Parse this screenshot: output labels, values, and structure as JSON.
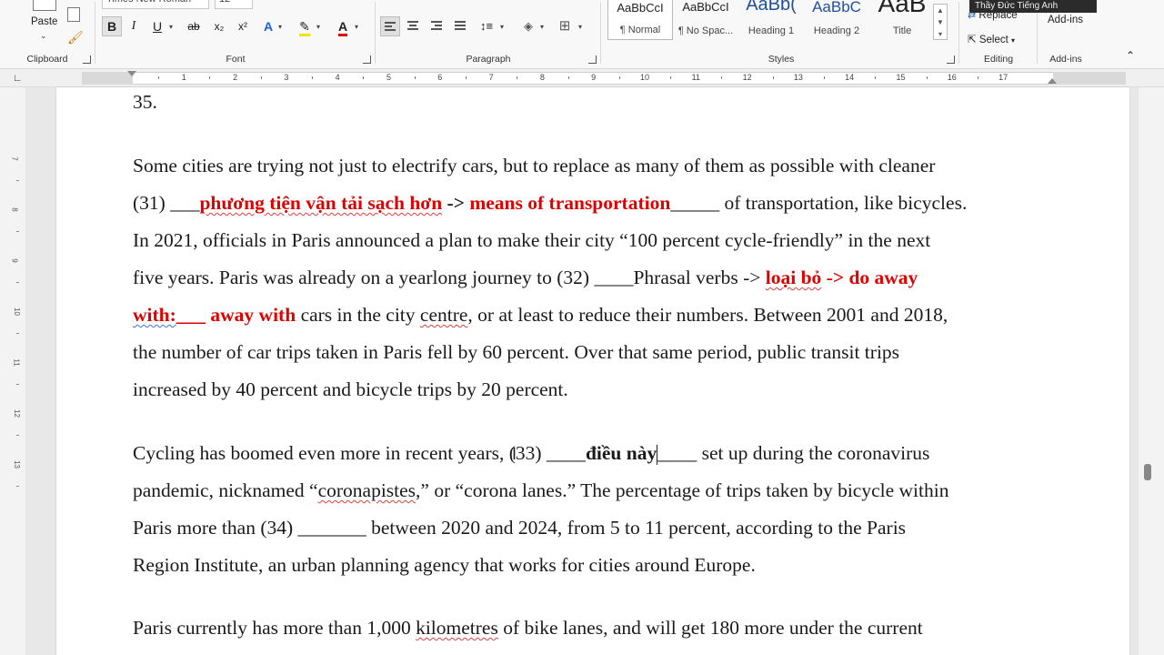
{
  "ribbon": {
    "presenter_label": "Thầy Đức Tiếng Anh",
    "clipboard": {
      "paste_label": "Paste",
      "group_label": "Clipboard"
    },
    "font": {
      "font_name": "Times New Roman",
      "font_size": "12",
      "group_label": "Font"
    },
    "paragraph": {
      "group_label": "Paragraph"
    },
    "styles": {
      "group_label": "Styles",
      "items": [
        {
          "sample": "AaBbCcI",
          "name": "¶ Normal"
        },
        {
          "sample": "AaBbCcI",
          "name": "¶ No Spac..."
        },
        {
          "sample": "AaBb(",
          "name": "Heading 1"
        },
        {
          "sample": "AaBbC",
          "name": "Heading 2"
        },
        {
          "sample": "AaB",
          "name": "Title"
        }
      ]
    },
    "editing": {
      "replace_label": "Replace",
      "select_label": "Select",
      "group_label": "Editing"
    },
    "addins": {
      "label": "Add-ins",
      "group_label": "Add-ins"
    }
  },
  "ruler": {
    "numbers": [
      "1",
      "2",
      "3",
      "4",
      "5",
      "6",
      "7",
      "8",
      "9",
      "10",
      "11",
      "12",
      "13",
      "14",
      "15",
      "16",
      "17"
    ],
    "vertical_numbers": [
      "7",
      "8",
      "9",
      "10",
      "11",
      "12",
      "13"
    ]
  },
  "document": {
    "top_number": "35.",
    "p1": {
      "a": "Some cities are trying not just to electrify cars, but to replace as many of them as possible with cleaner",
      "b": "(31) ___",
      "c": "phương tiện vận tải sạch hơn",
      "d": " -> ",
      "e": "means of transportation",
      "f": "_____ of transportation, like bicycles.",
      "g": "In 2021, officials in Paris announced a plan to make their city “100 percent cycle-friendly” in the next",
      "h": "five years. Paris was already on a yearlong journey to (32) ____Phrasal verbs -> ",
      "i": "loại bỏ",
      "j": " -> do away",
      "k": "with:",
      "l": "___ away with",
      "m": " cars in the city ",
      "n": "centre",
      "o": ", or at least to reduce their numbers. Between 2001 and 2018,",
      "p": "the number of car trips taken in Paris fell by 60 percent. Over that same period, public transit trips",
      "q": "increased by 40 percent and bicycle trips by 20 percent."
    },
    "p2": {
      "a": "Cycling has boomed even more in recent years, (33) ____",
      "b": "điều này",
      "c": "____ set up during the coronavirus",
      "d": "pandemic, nicknamed “",
      "e": "coronapistes",
      "f": ",” or “corona lanes.” The percentage of trips taken by bicycle within",
      "g": "Paris more than (34) _______ between 2020 and 2024, from 5 to 11 percent, according to the Paris",
      "h": "Region Institute, an urban planning agency that works for cities around Europe."
    },
    "p3": {
      "a": "Paris currently has more than 1,000 ",
      "b": "kilometres",
      "c": " of bike lanes, and will get 180 more under the current"
    }
  }
}
